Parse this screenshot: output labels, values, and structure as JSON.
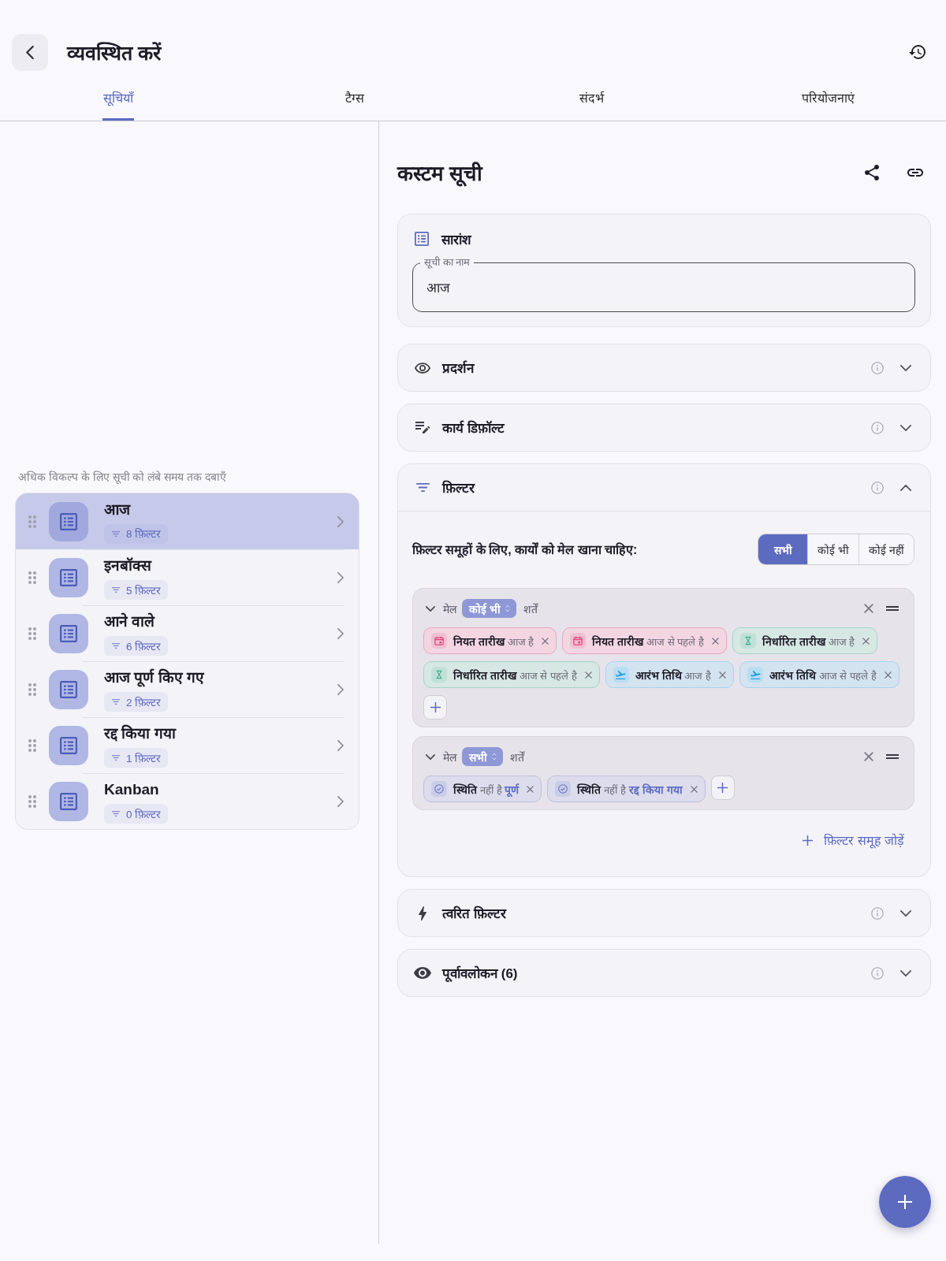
{
  "header": {
    "title": "व्यवस्थित करें"
  },
  "tabs": [
    {
      "label": "सूचियाँ",
      "selected": true
    },
    {
      "label": "टैग्स",
      "selected": false
    },
    {
      "label": "संदर्भ",
      "selected": false
    },
    {
      "label": "परियोजनाएं",
      "selected": false
    }
  ],
  "lists_panel": {
    "hint": "अधिक विकल्प के लिए सूची को लंबे समय तक दबाएँ",
    "items": [
      {
        "title": "आज",
        "filters": "8 फ़िल्टर",
        "selected": true
      },
      {
        "title": "इनबॉक्स",
        "filters": "5 फ़िल्टर",
        "selected": false
      },
      {
        "title": "आने वाले",
        "filters": "6 फ़िल्टर",
        "selected": false
      },
      {
        "title": "आज पूर्ण किए गए",
        "filters": "2 फ़िल्टर",
        "selected": false
      },
      {
        "title": "रद्द किया गया",
        "filters": "1 फ़िल्टर",
        "selected": false
      },
      {
        "title": "Kanban",
        "filters": "0 फ़िल्टर",
        "selected": false
      }
    ]
  },
  "detail": {
    "title": "कस्टम सूची",
    "summary": {
      "title": "सारांश",
      "name_field": {
        "label": "सूची का नाम",
        "value": "आज"
      }
    },
    "sections": [
      {
        "kind": "display",
        "title": "प्रदर्शन",
        "expanded": false
      },
      {
        "kind": "task_defaults",
        "title": "कार्य डिफ़ॉल्ट",
        "expanded": false
      },
      {
        "kind": "filters",
        "title": "फ़िल्टर",
        "expanded": true,
        "match_prompt": "फ़िल्टर समूहों के लिए, कार्यों को मेल खाना चाहिए:",
        "match_options": [
          {
            "label": "सभी",
            "selected": true
          },
          {
            "label": "कोई भी",
            "selected": false
          },
          {
            "label": "कोई नहीं",
            "selected": false
          }
        ],
        "groups": [
          {
            "expanded": true,
            "match_label": "मेल",
            "match_value": "कोई भी",
            "conditions_label": "शर्तें",
            "conditions": [
              {
                "kind": "due_date",
                "field": "नियत तारीख",
                "operator": "आज है"
              },
              {
                "kind": "due_date",
                "field": "नियत तारीख",
                "operator": "आज से पहले है"
              },
              {
                "kind": "scheduled_date",
                "field": "निर्धारित तारीख",
                "operator": "आज है"
              },
              {
                "kind": "scheduled_date",
                "field": "निर्धारित तारीख",
                "operator": "आज से पहले है"
              },
              {
                "kind": "start_date",
                "field": "आरंभ तिथि",
                "operator": "आज है"
              },
              {
                "kind": "start_date",
                "field": "आरंभ तिथि",
                "operator": "आज से पहले है"
              }
            ]
          },
          {
            "expanded": true,
            "match_label": "मेल",
            "match_value": "सभी",
            "conditions_label": "शर्तें",
            "conditions": [
              {
                "kind": "status",
                "field": "स्थिति",
                "operator": "नहीं है",
                "value": "पूर्ण"
              },
              {
                "kind": "status",
                "field": "स्थिति",
                "operator": "नहीं है",
                "value": "रद्द किया गया"
              }
            ]
          }
        ],
        "add_group": "फ़िल्टर समूह जोड़ें"
      },
      {
        "kind": "quick_filters",
        "title": "त्वरित फ़िल्टर",
        "expanded": false
      },
      {
        "kind": "preview",
        "title": "पूर्वावलोकन (6)",
        "expanded": false
      }
    ]
  }
}
